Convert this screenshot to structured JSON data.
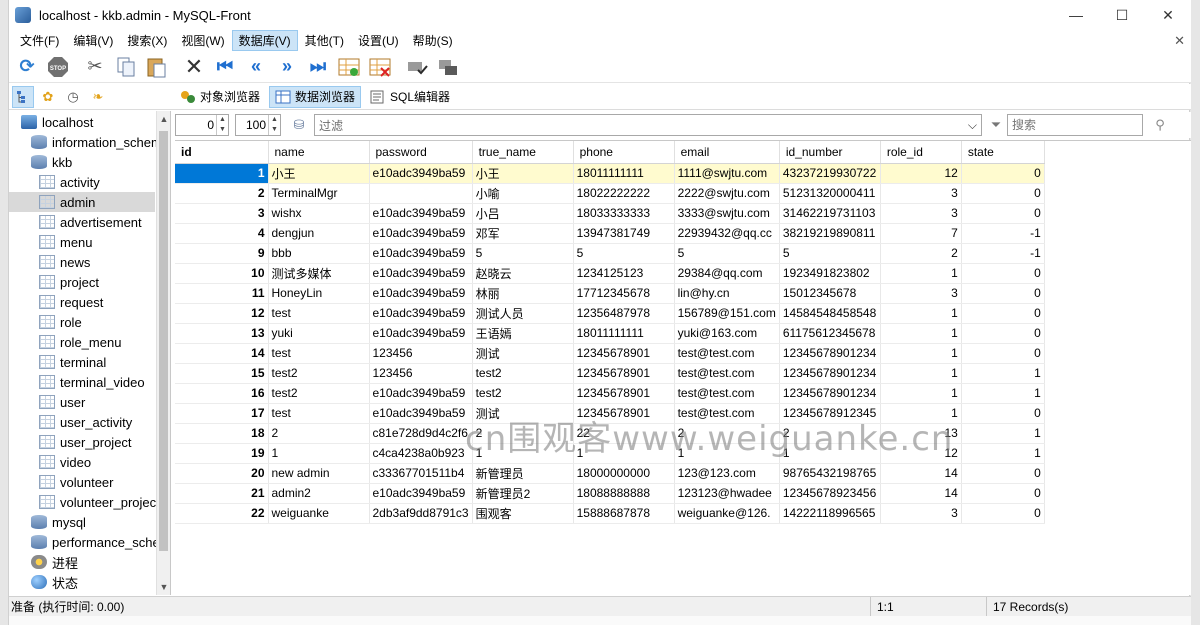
{
  "window": {
    "title": "localhost - kkb.admin - MySQL-Front",
    "minimize": "—",
    "maximize": "☐",
    "close": "✕"
  },
  "menu": [
    {
      "label": "文件(F)"
    },
    {
      "label": "编辑(V)"
    },
    {
      "label": "搜索(X)"
    },
    {
      "label": "视图(W)"
    },
    {
      "label": "数据库(V)"
    },
    {
      "label": "其他(T)"
    },
    {
      "label": "设置(U)"
    },
    {
      "label": "帮助(S)"
    }
  ],
  "menu_active_index": 4,
  "views": {
    "object_browser": "对象浏览器",
    "data_browser": "数据浏览器",
    "sql_editor": "SQL编辑器"
  },
  "filter": {
    "offset": "0",
    "limit": "100",
    "placeholder": "过滤",
    "search_placeholder": "搜索"
  },
  "tree": [
    {
      "label": "localhost",
      "level": 0,
      "icon": "host"
    },
    {
      "label": "information_schema",
      "level": 1,
      "icon": "db"
    },
    {
      "label": "kkb",
      "level": 1,
      "icon": "db"
    },
    {
      "label": "activity",
      "level": 2,
      "icon": "table"
    },
    {
      "label": "admin",
      "level": 2,
      "icon": "table",
      "selected": true
    },
    {
      "label": "advertisement",
      "level": 2,
      "icon": "table"
    },
    {
      "label": "menu",
      "level": 2,
      "icon": "table"
    },
    {
      "label": "news",
      "level": 2,
      "icon": "table"
    },
    {
      "label": "project",
      "level": 2,
      "icon": "table"
    },
    {
      "label": "request",
      "level": 2,
      "icon": "table"
    },
    {
      "label": "role",
      "level": 2,
      "icon": "table"
    },
    {
      "label": "role_menu",
      "level": 2,
      "icon": "table"
    },
    {
      "label": "terminal",
      "level": 2,
      "icon": "table"
    },
    {
      "label": "terminal_video",
      "level": 2,
      "icon": "table"
    },
    {
      "label": "user",
      "level": 2,
      "icon": "table"
    },
    {
      "label": "user_activity",
      "level": 2,
      "icon": "table"
    },
    {
      "label": "user_project",
      "level": 2,
      "icon": "table"
    },
    {
      "label": "video",
      "level": 2,
      "icon": "table"
    },
    {
      "label": "volunteer",
      "level": 2,
      "icon": "table"
    },
    {
      "label": "volunteer_project",
      "level": 2,
      "icon": "table"
    },
    {
      "label": "mysql",
      "level": 1,
      "icon": "db"
    },
    {
      "label": "performance_schema",
      "level": 1,
      "icon": "db"
    },
    {
      "label": "进程",
      "level": 1,
      "icon": "proc"
    },
    {
      "label": "状态",
      "level": 1,
      "icon": "status"
    }
  ],
  "grid": {
    "columns": [
      "id",
      "name",
      "password",
      "true_name",
      "phone",
      "email",
      "id_number",
      "role_id",
      "state"
    ],
    "rows": [
      [
        "1",
        "小王",
        "e10adc3949ba59",
        "小王",
        "18011111111",
        "1111@swjtu.com",
        "43237219930722",
        "12",
        "0"
      ],
      [
        "2",
        "TerminalMgr",
        "",
        "小喻",
        "18022222222",
        "2222@swjtu.com",
        "51231320000411",
        "3",
        "0"
      ],
      [
        "3",
        "wishx",
        "e10adc3949ba59",
        "小吕",
        "18033333333",
        "3333@swjtu.com",
        "31462219731103",
        "3",
        "0"
      ],
      [
        "4",
        "dengjun",
        "e10adc3949ba59",
        "邓军",
        "13947381749",
        "22939432@qq.cc",
        "38219219890811",
        "7",
        "-1"
      ],
      [
        "9",
        "bbb",
        "e10adc3949ba59",
        "5",
        "5",
        "5",
        "5",
        "2",
        "-1"
      ],
      [
        "10",
        "测试多媒体",
        "e10adc3949ba59",
        "赵晓云",
        "1234125123",
        "29384@qq.com",
        "1923491823802",
        "1",
        "0"
      ],
      [
        "11",
        "HoneyLin",
        "e10adc3949ba59",
        "林丽",
        "17712345678",
        "lin@hy.cn",
        "15012345678",
        "3",
        "0"
      ],
      [
        "12",
        "test",
        "e10adc3949ba59",
        "测试人员",
        "12356487978",
        "156789@151.com",
        "14584548458548",
        "1",
        "0"
      ],
      [
        "13",
        "yuki",
        "e10adc3949ba59",
        "王语嫣",
        "18011111111",
        "yuki@163.com",
        "61175612345678",
        "1",
        "0"
      ],
      [
        "14",
        "test",
        "123456",
        "测试",
        "12345678901",
        "test@test.com",
        "12345678901234",
        "1",
        "0"
      ],
      [
        "15",
        "test2",
        "123456",
        "test2",
        "12345678901",
        "test@test.com",
        "12345678901234",
        "1",
        "1"
      ],
      [
        "16",
        "test2",
        "e10adc3949ba59",
        "test2",
        "12345678901",
        "test@test.com",
        "12345678901234",
        "1",
        "1"
      ],
      [
        "17",
        "test",
        "e10adc3949ba59",
        "测试",
        "12345678901",
        "test@test.com",
        "12345678912345",
        "1",
        "0"
      ],
      [
        "18",
        "2",
        "c81e728d9d4c2f6",
        "2",
        "22",
        "2",
        "2",
        "13",
        "1"
      ],
      [
        "19",
        "1",
        "c4ca4238a0b923",
        "1",
        "1",
        "1",
        "1",
        "12",
        "1"
      ],
      [
        "20",
        "new admin",
        "c33367701511b4",
        "新管理员",
        "18000000000",
        "123@123.com",
        "98765432198765",
        "14",
        "0"
      ],
      [
        "21",
        "admin2",
        "e10adc3949ba59",
        "新管理员2",
        "18088888888",
        "123123@hwadee",
        "12345678923456",
        "14",
        "0"
      ],
      [
        "22",
        "weiguanke",
        "2db3af9dd8791c3",
        "围观客",
        "15888687878",
        "weiguanke@126.",
        "14222118996565",
        "3",
        "0"
      ]
    ]
  },
  "watermark": "cn围观客www.weiguanke.cn",
  "status": {
    "ready": "准备  (执行时间: 0.00)",
    "position": "1:1",
    "records": "17 Records(s)"
  },
  "colors": {
    "selection": "#0078d7",
    "current_row": "#fffbcf",
    "pressed": "#cce4f7"
  }
}
